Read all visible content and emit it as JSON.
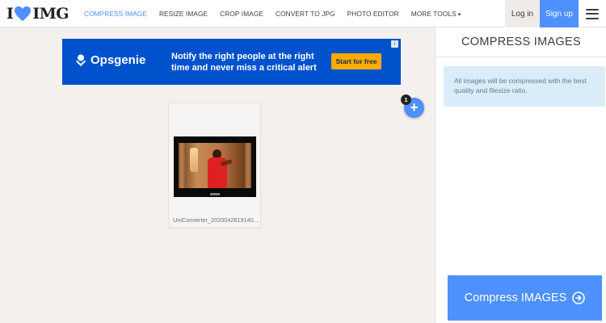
{
  "header": {
    "logo": {
      "left": "I",
      "right": "IMG",
      "heart_icon": "heart-icon"
    },
    "nav": [
      {
        "label": "COMPRESS IMAGE",
        "active": true
      },
      {
        "label": "RESIZE IMAGE",
        "active": false
      },
      {
        "label": "CROP IMAGE",
        "active": false
      },
      {
        "label": "CONVERT TO JPG",
        "active": false
      },
      {
        "label": "PHOTO EDITOR",
        "active": false
      },
      {
        "label": "MORE TOOLS",
        "active": false,
        "caret": "▾"
      }
    ],
    "login_label": "Log in",
    "signup_label": "Sign up",
    "menu_icon": "hamburger-icon"
  },
  "ad": {
    "brand": "Opsgenie",
    "headline": "Notify the right people at the right time and never miss a critical alert",
    "cta": "Start for free",
    "info_icon": "info-icon"
  },
  "file": {
    "name": "UniConverter_2020042619140...",
    "count": "1",
    "add_symbol": "+"
  },
  "sidebar": {
    "title": "COMPRESS IMAGES",
    "info": "All images will be compressed with the best quality and filesize ratio.",
    "compress_label": "Compress IMAGES",
    "compress_icon": "arrow-right-circle-icon"
  },
  "colors": {
    "accent": "#4d90fe",
    "ad_bg": "#0052cc",
    "ad_cta": "#ffab00",
    "info_bg": "#d9ecf8",
    "page_bg": "#f3f0ed"
  }
}
